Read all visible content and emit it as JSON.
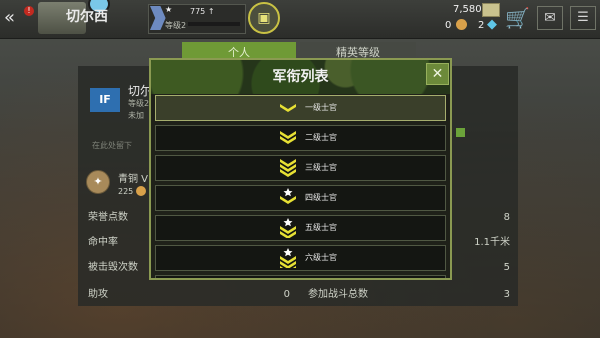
{
  "topbar": {
    "tank_name": "切尔西",
    "tank_sub": "",
    "rank_exp": "775",
    "rank_level": "等级2",
    "rank_star": "★",
    "gold": "7,580",
    "silver": "0",
    "gems": "2"
  },
  "tabs": {
    "active": "个人",
    "inactive": "精英等级"
  },
  "player": {
    "flag": "IF",
    "name": "切尔",
    "level": "等级2",
    "unit": "未加",
    "note": "在此处留下",
    "bronze_label": "青铜 V",
    "bronze_value": "225"
  },
  "stats": {
    "left": [
      {
        "label": "荣誉点数",
        "value": ""
      },
      {
        "label": "命中率",
        "value": ""
      },
      {
        "label": "被击毁次数",
        "value": ""
      },
      {
        "label": "助攻",
        "value": "0"
      }
    ],
    "right": [
      {
        "label": "",
        "value": "8"
      },
      {
        "label": "",
        "value": "1.1千米"
      },
      {
        "label": "",
        "value": "5"
      },
      {
        "label": "参加战斗总数",
        "value": "3"
      }
    ]
  },
  "modal": {
    "title": "军衔列表",
    "close": "✕",
    "ranks": [
      {
        "label": "一级士官",
        "chevrons": 1,
        "star": false
      },
      {
        "label": "二级士官",
        "chevrons": 2,
        "star": false
      },
      {
        "label": "三级士官",
        "chevrons": 3,
        "star": false
      },
      {
        "label": "四级士官",
        "chevrons": 1,
        "star": true
      },
      {
        "label": "五级士官",
        "chevrons": 2,
        "star": true
      },
      {
        "label": "六级士官",
        "chevrons": 3,
        "star": true
      },
      {
        "label": "",
        "chevrons": 1,
        "star": true
      }
    ]
  },
  "colors": {
    "accent_green": "#6f9a36",
    "modal_border": "#8b9a52",
    "chevron": "#e6e034"
  },
  "icons": {
    "back": "double-chevron-left",
    "shop": "cart",
    "mail": "envelope",
    "chat": "speech-bubble"
  }
}
